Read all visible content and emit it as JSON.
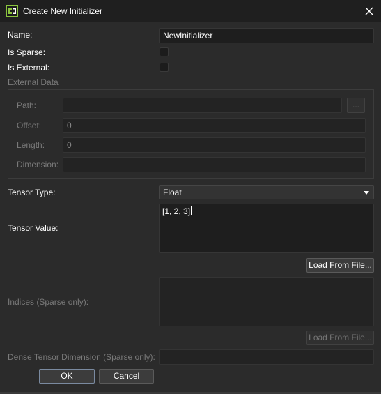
{
  "window": {
    "title": "Create New Initializer"
  },
  "form": {
    "name_label": "Name:",
    "name_value": "NewInitializer",
    "sparse_label": "Is Sparse:",
    "external_label": "Is External:",
    "external_group_label": "External Data",
    "path_label": "Path:",
    "path_value": "",
    "browse_label": "...",
    "offset_label": "Offset:",
    "offset_value": "0",
    "length_label": "Length:",
    "length_value": "0",
    "dimension_label": "Dimension:",
    "dimension_value": "",
    "tensor_type_label": "Tensor Type:",
    "tensor_type_value": "Float",
    "tensor_value_label": "Tensor Value:",
    "tensor_value_text": "[1, 2, 3]",
    "load_from_file_label": "Load From File...",
    "indices_label": "Indices (Sparse only):",
    "indices_value": "",
    "load_from_file_disabled_label": "Load From File...",
    "dense_dim_label": "Dense Tensor Dimension (Sparse only):",
    "dense_dim_value": ""
  },
  "buttons": {
    "ok": "OK",
    "cancel": "Cancel"
  },
  "icons": {
    "app": "app-icon",
    "close": "close-icon",
    "dropdown": "chevron-down-icon"
  },
  "colors": {
    "background": "#2b2b2b",
    "titlebar": "#1f1f1f",
    "field": "#1e1e1e",
    "app_icon": "#8ac43f"
  }
}
